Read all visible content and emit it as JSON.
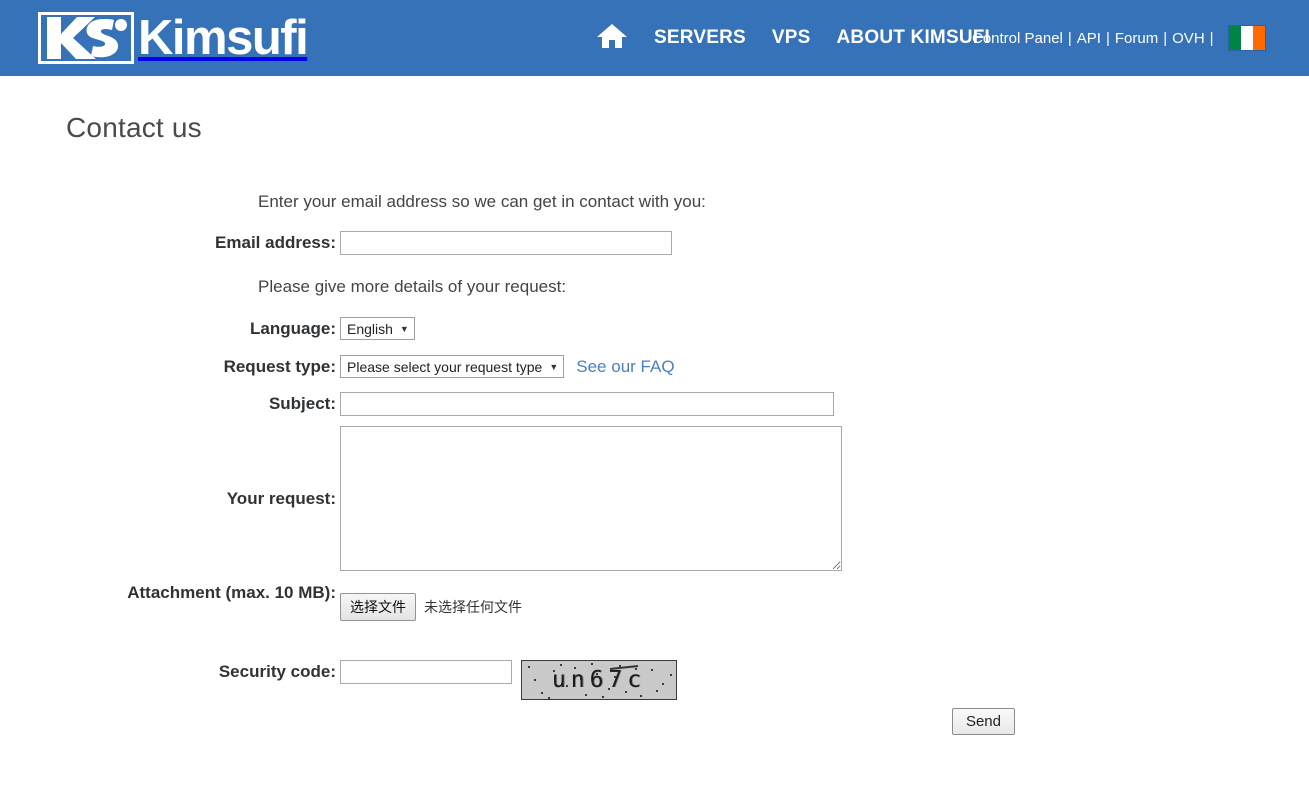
{
  "header": {
    "brand": {
      "mark": "ks-logo-icon",
      "word": "Kimsufi"
    },
    "home_icon": "home-icon",
    "nav": [
      {
        "label": "SERVERS"
      },
      {
        "label": "VPS"
      },
      {
        "label": "ABOUT KIMSUFI"
      }
    ],
    "util": [
      {
        "label": "Control Panel"
      },
      {
        "label": "API"
      },
      {
        "label": "Forum"
      },
      {
        "label": "OVH"
      }
    ],
    "separator": "|",
    "flag": {
      "name": "ireland-flag-icon",
      "colors": [
        "#018448",
        "#ffffff",
        "#ff6a00"
      ]
    },
    "background_color": "#3572b8"
  },
  "page": {
    "title": "Contact us",
    "intro_email": "Enter your email address so we can get in contact with you:",
    "intro_details": "Please give more details of your request:"
  },
  "form": {
    "email": {
      "label": "Email address:",
      "value": "",
      "placeholder": ""
    },
    "language": {
      "label": "Language:",
      "selected": "English",
      "caret": "▼"
    },
    "request_type": {
      "label": "Request type:",
      "selected": "Please select your request type",
      "caret": "▼",
      "faq_link": "See our FAQ",
      "faq_link_color": "#4a7fc1"
    },
    "subject": {
      "label": "Subject:",
      "value": "",
      "placeholder": ""
    },
    "request": {
      "label": "Your request:",
      "value": "",
      "placeholder": ""
    },
    "attachment": {
      "label": "Attachment (max. 10 MB):",
      "button_label": "选择文件",
      "status_text": "未选择任何文件"
    },
    "security": {
      "label": "Security code:",
      "value": "",
      "captcha_text": "un67c"
    },
    "submit": {
      "label": "Send"
    }
  }
}
